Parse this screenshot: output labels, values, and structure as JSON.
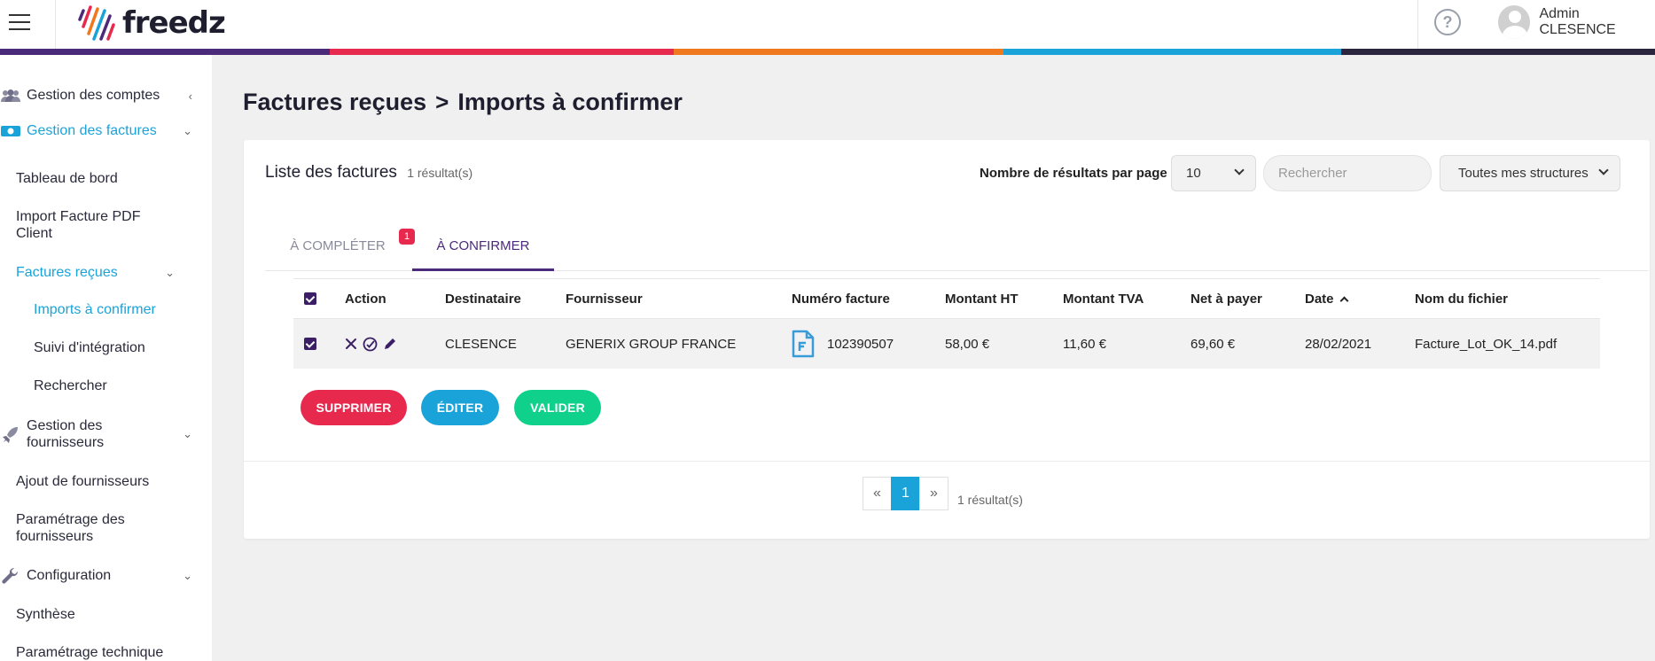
{
  "header": {
    "logo_text": "freedz",
    "help_label": "?",
    "user_name": "Admin CLESENCE",
    "color_stripe": [
      "#4b2a7a",
      "#e8294e",
      "#f0781e",
      "#1aa3d9",
      "#2b2540"
    ]
  },
  "sidebar": {
    "items": [
      {
        "label": "Gestion des comptes",
        "icon": "users-icon"
      },
      {
        "label": "Gestion des factures",
        "icon": "money-icon"
      },
      {
        "label": "Tableau de bord"
      },
      {
        "label": "Import Facture PDF Client"
      },
      {
        "label": "Factures reçues"
      },
      {
        "label": "Imports à confirmer"
      },
      {
        "label": "Suivi d'intégration"
      },
      {
        "label": "Rechercher"
      },
      {
        "label": "Gestion des fournisseurs",
        "icon": "rocket-icon"
      },
      {
        "label": "Ajout de fournisseurs"
      },
      {
        "label": "Paramétrage des fournisseurs"
      },
      {
        "label": "Configuration",
        "icon": "wrench-icon"
      },
      {
        "label": "Synthèse"
      },
      {
        "label": "Paramétrage technique"
      }
    ]
  },
  "breadcrumb": {
    "parent": "Factures reçues",
    "separator": ">",
    "current": "Imports à confirmer"
  },
  "list": {
    "title": "Liste des factures",
    "count": "1 résultat(s)",
    "per_page_label": "Nombre de résultats par page :",
    "per_page_value": "10",
    "search_placeholder": "Rechercher",
    "structure_filter": "Toutes mes structures"
  },
  "tabs": [
    {
      "label": "À COMPLÉTER",
      "badge": "1"
    },
    {
      "label": "À CONFIRMER"
    }
  ],
  "table": {
    "columns": [
      "Action",
      "Destinataire",
      "Fournisseur",
      "Numéro facture",
      "Montant HT",
      "Montant TVA",
      "Net à payer",
      "Date",
      "Nom du fichier"
    ],
    "rows": [
      {
        "destinataire": "CLESENCE",
        "fournisseur": "GENERIX GROUP FRANCE",
        "numero": "102390507",
        "montant_ht": "58,00 €",
        "montant_tva": "11,60 €",
        "net": "69,60 €",
        "date": "28/02/2021",
        "fichier": "Facture_Lot_OK_14.pdf"
      }
    ]
  },
  "buttons": {
    "supprimer": "SUPPRIMER",
    "editer": "ÉDITER",
    "valider": "VALIDER"
  },
  "pagination": {
    "prev": "«",
    "page": "1",
    "next": "»",
    "count": "1 résultat(s)"
  }
}
